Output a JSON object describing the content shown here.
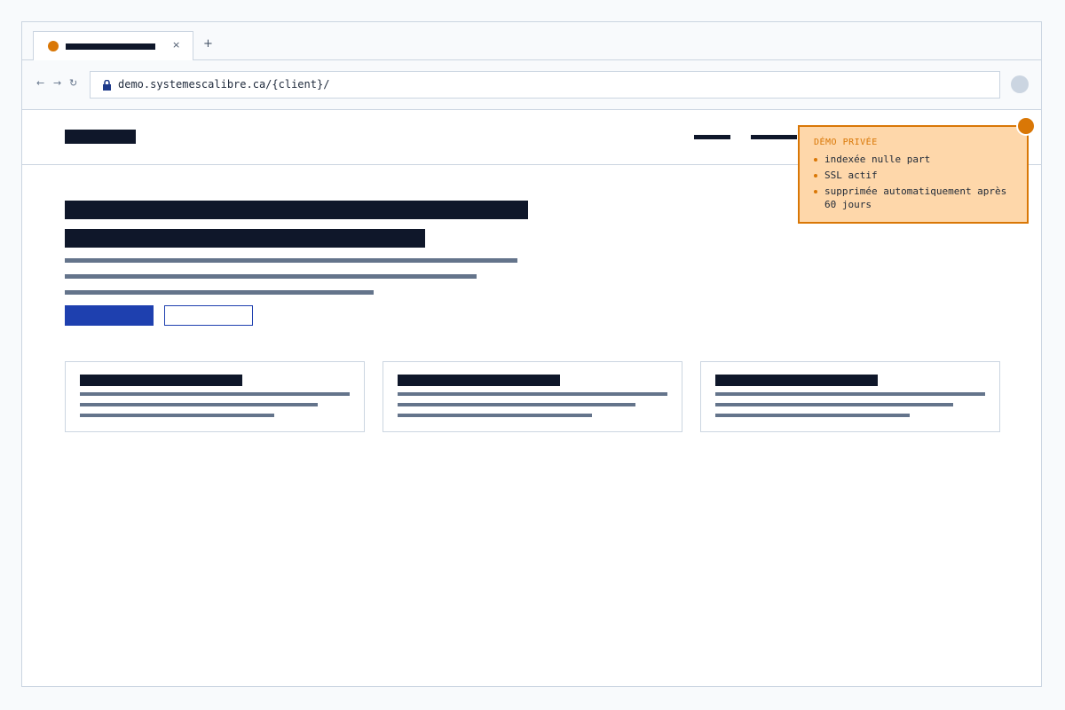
{
  "browser": {
    "tab_close_glyph": "×",
    "tab_new_glyph": "+",
    "nav_back_glyph": "←",
    "nav_forward_glyph": "→",
    "nav_reload_glyph": "↻",
    "url": "demo.systemescalibre.ca/{client}/"
  },
  "notice": {
    "title": "DÉMO PRIVÉE",
    "items": [
      "indexée nulle part",
      "SSL actif",
      "supprimée automatiquement après 60 jours"
    ]
  },
  "colors": {
    "accent": "#d97706",
    "notice_bg": "#fed7aa",
    "primary": "#1e40af",
    "ink": "#0f172a",
    "muted": "#64748b",
    "border": "#cbd5e1"
  },
  "icons": {
    "favicon": "favicon-icon",
    "lock": "lock-icon",
    "profile": "profile-avatar-icon"
  }
}
